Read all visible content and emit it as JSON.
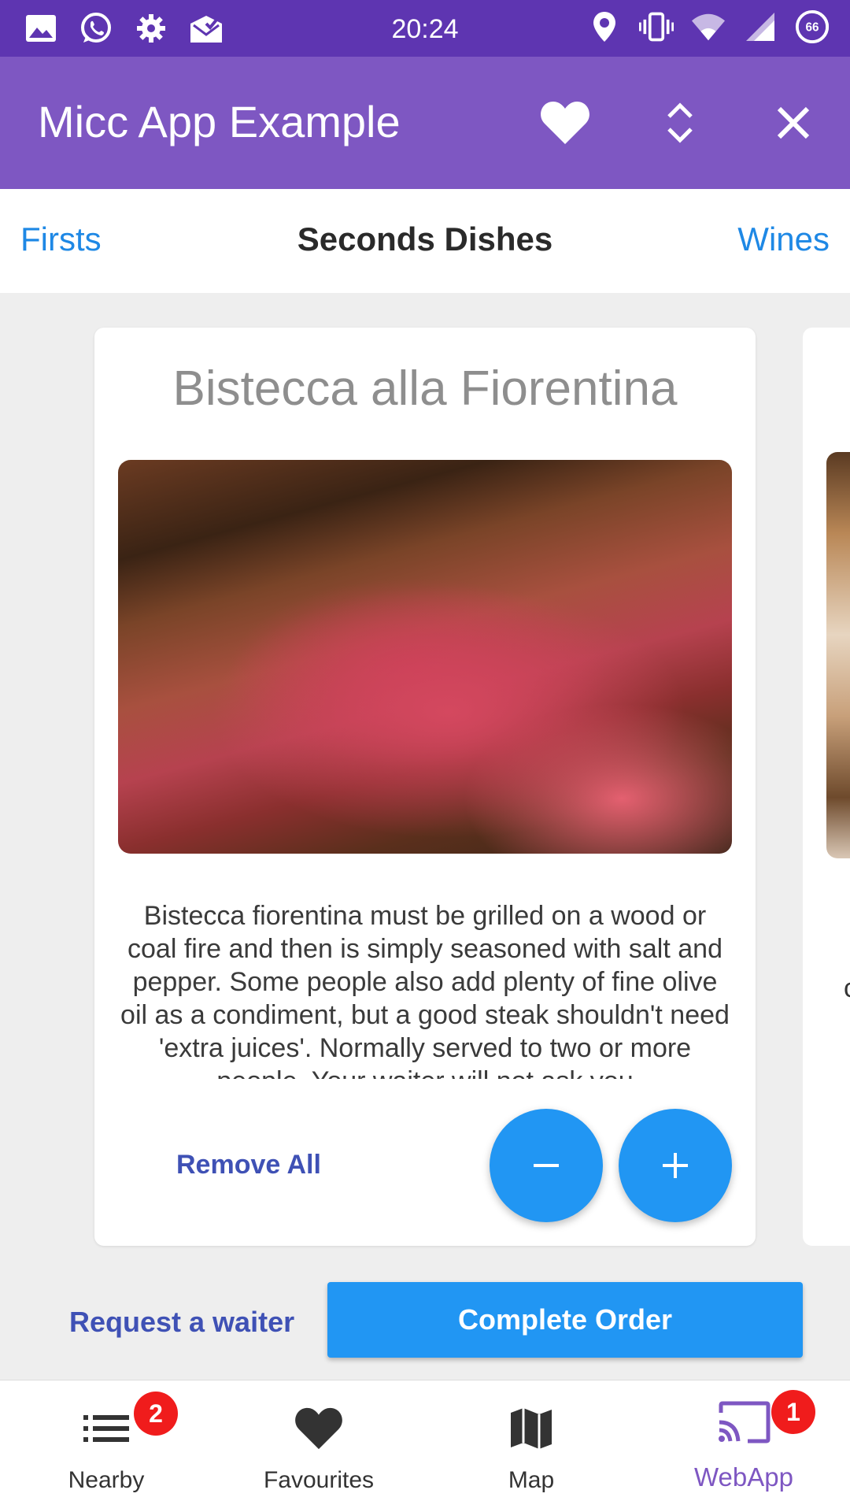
{
  "status_bar": {
    "time": "20:24",
    "battery": "66"
  },
  "app_bar": {
    "title": "Micc App Example"
  },
  "tabs": {
    "left": "Firsts",
    "active": "Seconds Dishes",
    "right": "Wines"
  },
  "card": {
    "title": "Bistecca alla Fiorentina",
    "description": "Bistecca fiorentina must be grilled on a wood or coal fire and then is simply seasoned with salt and pepper.  Some people also add plenty of fine olive oil as a condiment, but a good steak shouldn't need 'extra juices'.  Normally served to two or more people.  Your waiter will not ask you",
    "remove_all": "Remove All",
    "peek_text": "c"
  },
  "actions": {
    "request_waiter": "Request a waiter",
    "complete_order": "Complete Order"
  },
  "bottom_nav": [
    {
      "label": "Nearby",
      "icon": "list-icon",
      "badge": "2"
    },
    {
      "label": "Favourites",
      "icon": "heart-icon",
      "badge": ""
    },
    {
      "label": "Map",
      "icon": "map-icon",
      "badge": ""
    },
    {
      "label": "WebApp",
      "icon": "cast-icon",
      "badge": "1"
    }
  ],
  "colors": {
    "status_bar": "#5e35b1",
    "app_bar": "#7e57c2",
    "accent_blue": "#2196f3",
    "link_blue": "#1e88e5",
    "indigo": "#3f51b5",
    "badge_red": "#f01c1c"
  }
}
